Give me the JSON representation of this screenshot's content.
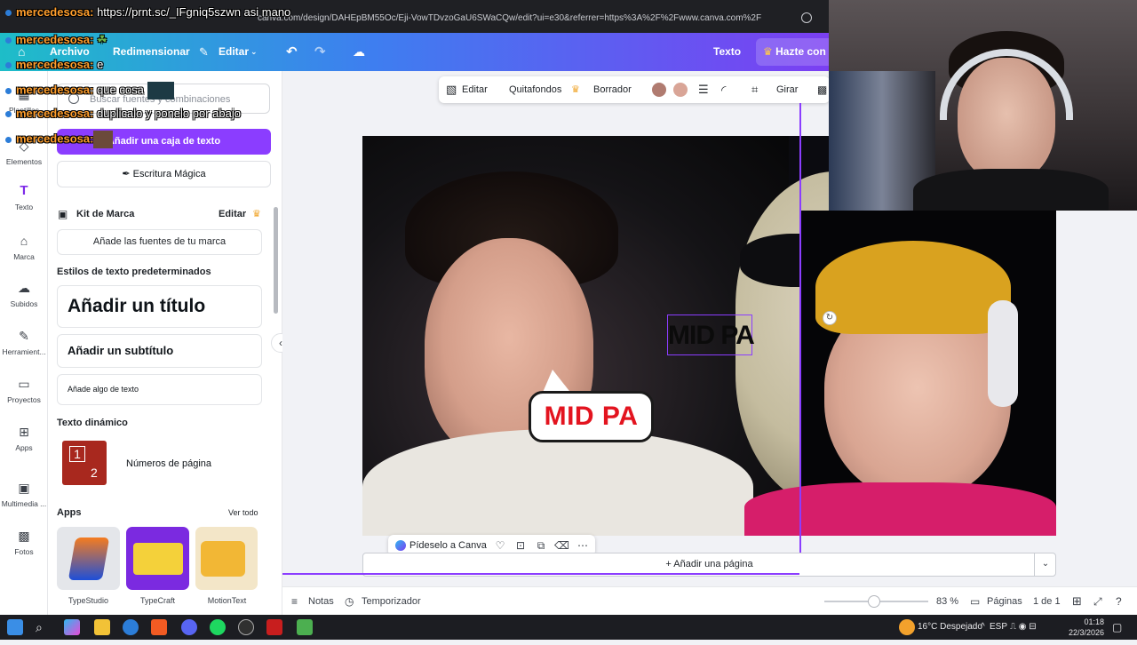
{
  "browser": {
    "url": "canva.com/design/DAHEpBM55Oc/Eji-VowTDvzoGaU6SWaCQw/edit?ui=e30&referrer=https%3A%2F%2Fwww.canva.com%2F"
  },
  "topbar": {
    "archivo": "Archivo",
    "redimensionar": "Redimensionar",
    "editar": "Editar",
    "texto": "Texto",
    "hazte": "Hazte con tu"
  },
  "rail": {
    "items": [
      {
        "label": "Plantillas",
        "icon": "template-icon"
      },
      {
        "label": "Elementos",
        "icon": "elements-icon"
      },
      {
        "label": "Texto",
        "icon": "text-icon"
      },
      {
        "label": "Marca",
        "icon": "brand-icon"
      },
      {
        "label": "Subidos",
        "icon": "upload-icon"
      },
      {
        "label": "Herramient...",
        "icon": "tools-icon"
      },
      {
        "label": "Proyectos",
        "icon": "folder-icon"
      },
      {
        "label": "Apps",
        "icon": "apps-icon"
      },
      {
        "label": "Multimedia ...",
        "icon": "media-icon"
      },
      {
        "label": "Fotos",
        "icon": "photo-icon"
      }
    ]
  },
  "panel": {
    "search_placeholder": "Buscar fuentes y combinaciones",
    "add_text_box": "Añadir una caja de texto",
    "magic_write": "Escritura Mágica",
    "brand_kit": "Kit de Marca",
    "brand_edit": "Editar",
    "brand_fonts": "Añade las fuentes de tu marca",
    "default_styles": "Estilos de texto predeterminados",
    "add_title": "Añadir un título",
    "add_subtitle": "Añadir un subtítulo",
    "add_body": "Añade algo de texto",
    "dynamic_text": "Texto dinámico",
    "page_numbers": "Números de página",
    "apps": "Apps",
    "see_all": "Ver todo",
    "app_tiles": [
      {
        "name": "TypeStudio",
        "color": "#e4e6ea"
      },
      {
        "name": "TypeCraft",
        "color": "#7b2ae0"
      },
      {
        "name": "MotionText",
        "color": "#f3e6c8"
      }
    ],
    "thumb_numbers": [
      "1",
      "2"
    ]
  },
  "context_toolbar": {
    "editar": "Editar",
    "quitafondos": "Quitafondos",
    "borrador": "Borrador",
    "girar": "Girar",
    "swatches": [
      "#b07b70",
      "#d9a597"
    ]
  },
  "canvas": {
    "bubble_text": "MID PA",
    "selected_text": "MID PA"
  },
  "action_pill": {
    "ask_canva": "Pídeselo a Canva"
  },
  "add_page": "+ Añadir una página",
  "statusbar": {
    "notas": "Notas",
    "temporizador": "Temporizador",
    "zoom": "83 %",
    "zoom_fraction": 0.48,
    "paginas": "Páginas",
    "page_count": "1 de 1"
  },
  "chat": [
    {
      "user": "mercedesosa:",
      "msg": " https://prnt.sc/_IFgniq5szwn asi mano"
    },
    {
      "user": "mercedesosa:",
      "msg": ""
    },
    {
      "user": "mercedesosa:",
      "msg": " e"
    },
    {
      "user": "mercedesosa:",
      "msg": " que cosa"
    },
    {
      "user": "mercedesosa:",
      "msg": " duplicalo y ponelo por abajo"
    },
    {
      "user": "mercedesosa:",
      "msg": ""
    }
  ],
  "taskbar": {
    "weather": "16°C  Despejado",
    "lang": "ESP",
    "time": "01:18",
    "date": "22/3/2026"
  },
  "colors": {
    "accent": "#8b3dff",
    "bubble_red": "#e3141f"
  }
}
